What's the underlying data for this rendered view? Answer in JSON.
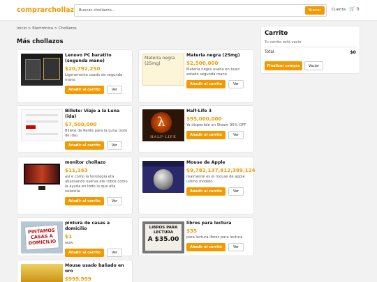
{
  "header": {
    "logo": "comprarchollazos",
    "search_placeholder": "Buscar chollazos...",
    "search_button": "Buscar",
    "account_label": "Cuenta",
    "cart_icon": "cart-icon",
    "cart_count": "0"
  },
  "breadcrumb": "Inicio > Electrónica > Chollazos",
  "page_title": "Más chollazos",
  "products": [
    {
      "name": "Lenovo PC baratito (segunda mano)",
      "price": "$20,792,250",
      "description": "Ligeramente usado de segunda mano",
      "add_label": "Añadir al carrito",
      "view_label": "Ver"
    },
    {
      "name": "Materia negra (25mg)",
      "image_alt": "Materia negra (25mg)",
      "price": "$2,500,000",
      "description": "Materia negra usada en buen estado segunda mano",
      "add_label": "Añadir al carrito",
      "view_label": "Ver"
    },
    {
      "name": "Billete: Viaje a la Luna (ida)",
      "price": "$7,500,000",
      "description": "Billete de Renfe para la Luna (solo de ida)",
      "add_label": "Añadir al carrito",
      "view_label": "Ver"
    },
    {
      "name": "Half-Life 3",
      "price": "$95,000,000",
      "description": "Ya disponible en Steam 95% OFF",
      "image_text": "HALF-LIFE",
      "add_label": "Añadir al carrito",
      "view_label": "Ver"
    },
    {
      "name": "monitor chollazo",
      "price": "$11,163",
      "description": "así e como la tenologia eta abansando oserva ete robos como la ayuda en todo lo que ella nesesita",
      "add_label": "Añadir al carrito",
      "view_label": "Ver"
    },
    {
      "name": "Mouse de Apple",
      "price": "$9,782,137,812,389,124",
      "description": "realmente es el mouse de apple ultimo modelo",
      "add_label": "Añadir al carrito",
      "view_label": "Ver"
    },
    {
      "name": "pintura de casas a domicilio",
      "price": "$1",
      "description": "wow",
      "image_text": "PINTAMOS CASAS A DOMICILIO",
      "add_label": "Añadir al carrito",
      "view_label": "Ver"
    },
    {
      "name": "libros para lectura",
      "price": "$35",
      "description": "para lectura libros para lectura",
      "image_text_top": "LIBROS PARA LECTURA",
      "image_text_big": "A $35.00",
      "add_label": "Añadir al carrito",
      "view_label": "Ver"
    },
    {
      "name": "Mouse usado bañado en oro",
      "price": "$999,999"
    }
  ],
  "cart": {
    "title": "Carrito",
    "empty_text": "Tu carrito está vacío",
    "total_label": "Total",
    "total_value": "$0",
    "checkout_label": "Finalizar compra",
    "clear_label": "Vaciar"
  },
  "colors": {
    "accent": "#f29a00",
    "background": "#f2f2f2"
  }
}
